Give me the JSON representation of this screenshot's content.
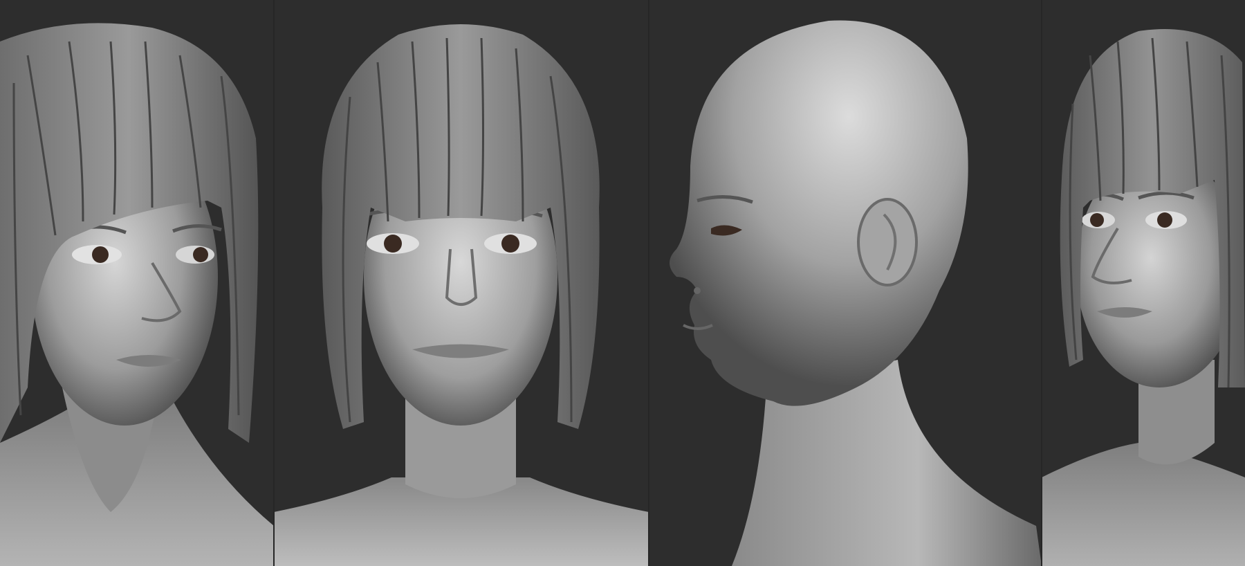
{
  "palette": {
    "background": "#2d2d2d",
    "skin_highlight": "#d8d8d8",
    "skin_mid": "#9a9a9a",
    "skin_shadow": "#4a4a4a",
    "hair_light": "#8e8e8e",
    "hair_dark": "#3e3e3e",
    "iris": "#3a2a22"
  },
  "panels": [
    {
      "view": "three-quarter-left-hair"
    },
    {
      "view": "front-hair"
    },
    {
      "view": "profile-bald"
    },
    {
      "view": "three-quarter-right-hair"
    }
  ]
}
